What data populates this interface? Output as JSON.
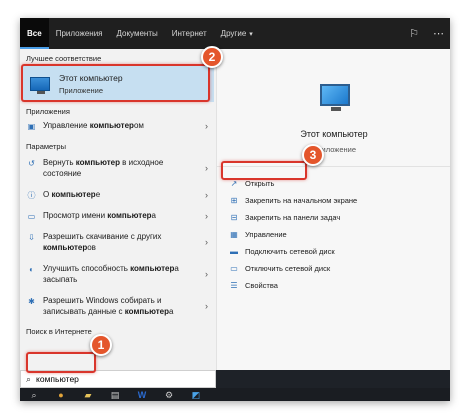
{
  "tabs": [
    {
      "label": "Все",
      "active": true
    },
    {
      "label": "Приложения"
    },
    {
      "label": "Документы"
    },
    {
      "label": "Интернет"
    },
    {
      "label": "Другие",
      "has_caret": true
    }
  ],
  "left": {
    "best_match_header": "Лучшее соответствие",
    "best_match": {
      "title": "Этот компьютер",
      "subtitle": "Приложение"
    },
    "apps_header": "Приложения",
    "apps": [
      {
        "icon": "computer-management-icon",
        "pre": "Управление ",
        "bold": "компьютер",
        "post": "ом"
      }
    ],
    "settings_header": "Параметры",
    "settings": [
      {
        "icon": "reset-icon",
        "pre": "Вернуть ",
        "bold": "компьютер",
        "post": " в исходное состояние"
      },
      {
        "icon": "info-icon",
        "pre": "О ",
        "bold": "компьютер",
        "post": "е"
      },
      {
        "icon": "display-icon",
        "pre": "Просмотр имени ",
        "bold": "компьютер",
        "post": "а"
      },
      {
        "icon": "download-icon",
        "pre": "Разрешить скачивание с других ",
        "bold": "компьютер",
        "post": "ов"
      },
      {
        "icon": "performance-icon",
        "pre": "Улучшить способность ",
        "bold": "компьютер",
        "post": "а засыпать"
      },
      {
        "icon": "bluetooth-icon",
        "pre": "Разрешить Windows собирать и записывать данные с ",
        "bold": "компьютер",
        "post": "а"
      }
    ],
    "web_header": "Поиск в Интернете"
  },
  "search": {
    "value": "компьютер",
    "placeholder": ""
  },
  "right": {
    "title": "Этот компьютер",
    "subtitle": "Приложение",
    "actions": [
      {
        "icon": "open-icon",
        "label": "Открыть"
      },
      {
        "icon": "pin-start-icon",
        "label": "Закрепить на начальном экране"
      },
      {
        "icon": "pin-taskbar-icon",
        "label": "Закрепить на панели задач"
      },
      {
        "icon": "manage-icon",
        "label": "Управление"
      },
      {
        "icon": "map-drive-icon",
        "label": "Подключить сетевой диск"
      },
      {
        "icon": "disconnect-drive-icon",
        "label": "Отключить сетевой диск"
      },
      {
        "icon": "properties-icon",
        "label": "Свойства"
      }
    ]
  },
  "badges": [
    "1",
    "2",
    "3"
  ],
  "colors": {
    "accent": "#1668b8",
    "highlight": "#d9352b",
    "badge": "#e4562c",
    "selection": "#c6dff1"
  }
}
